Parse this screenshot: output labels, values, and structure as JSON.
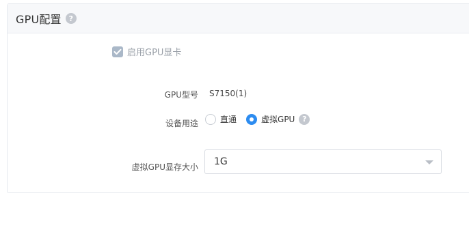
{
  "panel": {
    "title": "GPU配置",
    "help_glyph": "?"
  },
  "enable_gpu": {
    "label": "启用GPU显卡",
    "checked": true,
    "disabled": true
  },
  "gpu_model": {
    "label": "GPU型号",
    "value": "S7150(1)"
  },
  "device_usage": {
    "label": "设备用途",
    "options": [
      {
        "label": "直通",
        "selected": false
      },
      {
        "label": "虚拟GPU",
        "selected": true
      }
    ],
    "help_glyph": "?"
  },
  "vgpu_memory": {
    "label": "虚拟GPU显存大小",
    "selected_value": "1G"
  },
  "colors": {
    "accent": "#2d8cf0",
    "header_bg": "#f7f8fa",
    "border": "#e5e8ee",
    "help_icon": "#c4c8cf",
    "disabled_checkbox": "#aab8c8"
  },
  "icons": [
    "help-icon",
    "check-icon",
    "chevron-down-icon"
  ]
}
